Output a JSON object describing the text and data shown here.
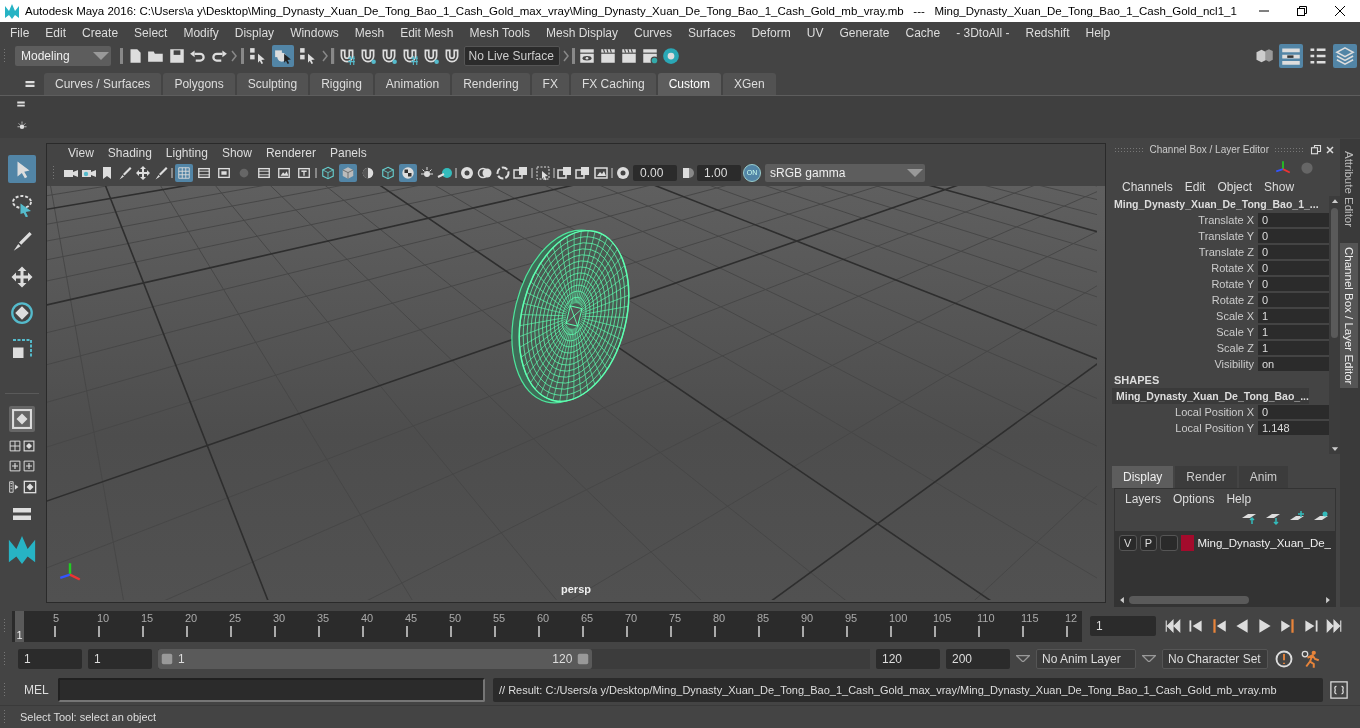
{
  "window": {
    "title": "Autodesk Maya 2016: C:\\Users\\a y\\Desktop\\Ming_Dynasty_Xuan_De_Tong_Bao_1_Cash_Gold_max_vray\\Ming_Dynasty_Xuan_De_Tong_Bao_1_Cash_Gold_mb_vray.mb   ---   Ming_Dynasty_Xuan_De_Tong_Bao_1_Cash_Gold_ncl1_1"
  },
  "menu_bar": [
    "File",
    "Edit",
    "Create",
    "Select",
    "Modify",
    "Display",
    "Windows",
    "Mesh",
    "Edit Mesh",
    "Mesh Tools",
    "Mesh Display",
    "Curves",
    "Surfaces",
    "Deform",
    "UV",
    "Generate",
    "Cache",
    "- 3DtoAll -",
    "Redshift",
    "Help"
  ],
  "status_line": {
    "menu_set": "Modeling",
    "selection_modes": [
      {
        "selected": false
      },
      {
        "selected": true
      },
      {
        "selected": false
      }
    ],
    "live_surface": "No Live Surface",
    "panel_layouts": [
      {
        "selected": false
      },
      {
        "selected": true
      },
      {
        "selected": false
      },
      {
        "selected": true
      }
    ]
  },
  "shelf": {
    "tabs": [
      {
        "label": "Curves / Surfaces",
        "selected": false
      },
      {
        "label": "Polygons",
        "selected": false
      },
      {
        "label": "Sculpting",
        "selected": false
      },
      {
        "label": "Rigging",
        "selected": false
      },
      {
        "label": "Animation",
        "selected": false
      },
      {
        "label": "Rendering",
        "selected": false
      },
      {
        "label": "FX",
        "selected": false
      },
      {
        "label": "FX Caching",
        "selected": false
      },
      {
        "label": "Custom",
        "selected": true
      },
      {
        "label": "XGen",
        "selected": false
      }
    ]
  },
  "toolbox": [
    {
      "selected": true
    },
    {
      "selected": false
    },
    {
      "selected": false
    },
    {
      "selected": false
    },
    {
      "selected": false
    },
    {
      "selected": false
    }
  ],
  "viewport": {
    "menus": [
      "View",
      "Shading",
      "Lighting",
      "Show",
      "Renderer",
      "Panels"
    ],
    "gate_toggles": [
      {
        "selected": true
      },
      {
        "selected": false
      },
      {
        "selected": false
      },
      {
        "selected": false
      },
      {
        "selected": false
      },
      {
        "selected": false
      },
      {
        "selected": false
      }
    ],
    "shading_toggles": [
      {
        "selected": false
      },
      {
        "selected": true
      },
      {
        "selected": false
      },
      {
        "selected": false
      },
      {
        "selected": true
      }
    ],
    "exposure": "0.00",
    "gamma": "1.00",
    "color_management": {
      "label": "ON",
      "on": true
    },
    "color_space": "sRGB gamma",
    "camera": "persp"
  },
  "channel_box": {
    "title": "Channel Box / Layer Editor",
    "menus": [
      "Channels",
      "Edit",
      "Object",
      "Show"
    ],
    "object": "Ming_Dynasty_Xuan_De_Tong_Bao_1_...",
    "attributes": [
      {
        "name": "Translate X",
        "value": "0"
      },
      {
        "name": "Translate Y",
        "value": "0"
      },
      {
        "name": "Translate Z",
        "value": "0"
      },
      {
        "name": "Rotate X",
        "value": "0"
      },
      {
        "name": "Rotate Y",
        "value": "0"
      },
      {
        "name": "Rotate Z",
        "value": "0"
      },
      {
        "name": "Scale X",
        "value": "1"
      },
      {
        "name": "Scale Y",
        "value": "1"
      },
      {
        "name": "Scale Z",
        "value": "1"
      },
      {
        "name": "Visibility",
        "value": "on"
      }
    ],
    "shapes_header": "SHAPES",
    "shape": "Ming_Dynasty_Xuan_De_Tong_Bao_...",
    "shape_attributes": [
      {
        "name": "Local Position X",
        "value": "0"
      },
      {
        "name": "Local Position Y",
        "value": "1.148"
      }
    ]
  },
  "layer_editor": {
    "tabs": [
      {
        "label": "Display",
        "selected": true
      },
      {
        "label": "Render",
        "selected": false
      },
      {
        "label": "Anim",
        "selected": false
      }
    ],
    "menus": [
      "Layers",
      "Options",
      "Help"
    ],
    "layers": [
      {
        "visible": "V",
        "playback": "P",
        "color": "#a30b2c",
        "name": "Ming_Dynasty_Xuan_De_"
      }
    ]
  },
  "side_tabs": [
    {
      "label": "Attribute Editor",
      "selected": false
    },
    {
      "label": "Channel Box / Layer Editor",
      "selected": true
    }
  ],
  "time_slider": {
    "level": 0,
    "current_frame": "1",
    "ticks": [
      "5",
      "10",
      "15",
      "20",
      "25",
      "30",
      "35",
      "40",
      "45",
      "50",
      "55",
      "60",
      "65",
      "70",
      "75",
      "80",
      "85",
      "90",
      "95",
      "100",
      "105",
      "110",
      "115",
      "12"
    ],
    "frame_field": "1"
  },
  "range_slider": {
    "level": 0.61,
    "start": "1",
    "playback_start": "1",
    "slider_start": "1",
    "slider_end": "120",
    "playback_end": "120",
    "end": "200",
    "anim_layer": "No Anim Layer",
    "character_set": "No Character Set"
  },
  "command_line": {
    "language": "MEL",
    "result": "// Result: C:/Users/a y/Desktop/Ming_Dynasty_Xuan_De_Tong_Bao_1_Cash_Gold_max_vray/Ming_Dynasty_Xuan_De_Tong_Bao_1_Cash_Gold_mb_vray.mb"
  },
  "help_line": "Select Tool: select an object"
}
